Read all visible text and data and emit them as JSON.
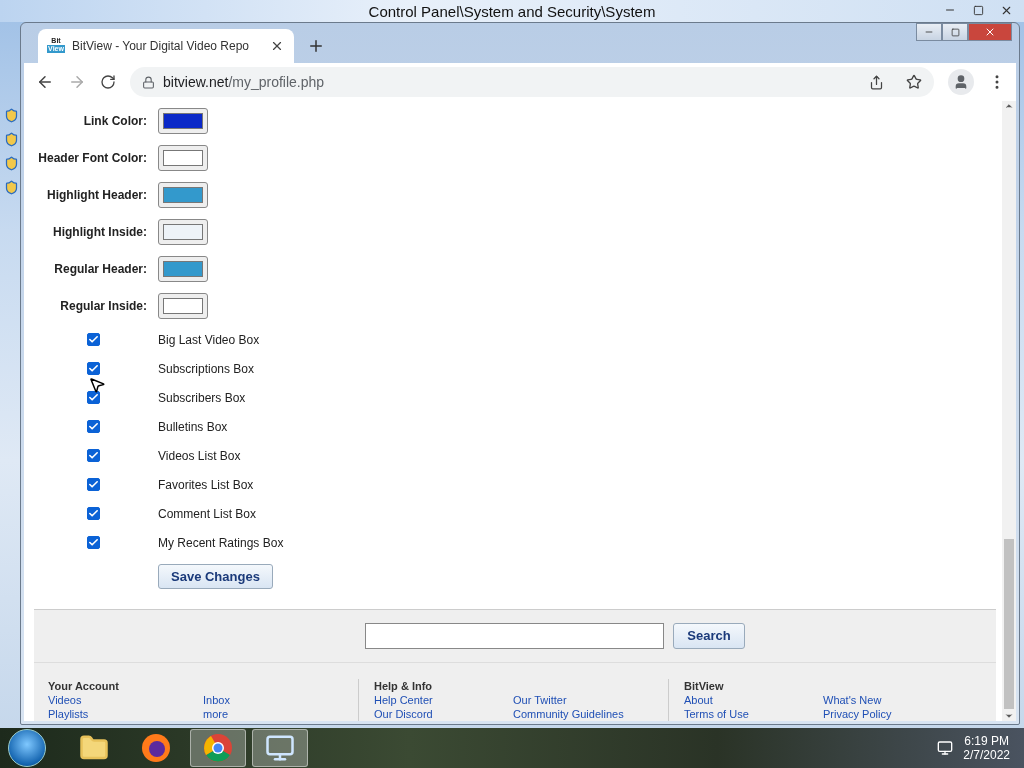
{
  "background_window": {
    "title": "Control Panel\\System and Security\\System"
  },
  "browser": {
    "tab": {
      "favicon_text": [
        "Bit",
        "View"
      ],
      "title": "BitView - Your Digital Video Repo"
    },
    "address": {
      "host": "bitview.net",
      "path": "/my_profile.php"
    }
  },
  "color_settings": [
    {
      "label": "Link Color:",
      "color": "#0a28c8"
    },
    {
      "label": "Header Font Color:",
      "color": "#ffffff"
    },
    {
      "label": "Highlight Header:",
      "color": "#3399cc"
    },
    {
      "label": "Highlight Inside:",
      "color": "#eef3f8"
    },
    {
      "label": "Regular Header:",
      "color": "#3399cc"
    },
    {
      "label": "Regular Inside:",
      "color": "#ffffff"
    }
  ],
  "boxes": [
    {
      "label": "Big Last Video Box",
      "checked": true
    },
    {
      "label": "Subscriptions Box",
      "checked": true
    },
    {
      "label": "Subscribers Box",
      "checked": true
    },
    {
      "label": "Bulletins Box",
      "checked": true
    },
    {
      "label": "Videos List Box",
      "checked": true
    },
    {
      "label": "Favorites List Box",
      "checked": true
    },
    {
      "label": "Comment List Box",
      "checked": true
    },
    {
      "label": "My Recent Ratings Box",
      "checked": true
    }
  ],
  "save_button": "Save Changes",
  "search": {
    "button": "Search"
  },
  "footer": {
    "columns": [
      {
        "title": "Your Account",
        "links": [
          "Videos",
          "Inbox",
          "Playlists",
          "more"
        ]
      },
      {
        "title": "Help & Info",
        "links": [
          "Help Center",
          "Our Twitter",
          "Our Discord",
          "Community Guidelines"
        ]
      },
      {
        "title": "BitView",
        "links": [
          "About",
          "What's New",
          "Terms of Use",
          "Privacy Policy"
        ]
      }
    ]
  },
  "taskbar": {
    "apps": [
      {
        "kind": "explorer",
        "selected": false
      },
      {
        "kind": "firefox",
        "selected": false
      },
      {
        "kind": "chrome",
        "selected": true
      },
      {
        "kind": "control-panel",
        "selected": true
      }
    ],
    "time": "6:19 PM",
    "date": "2/7/2022"
  }
}
